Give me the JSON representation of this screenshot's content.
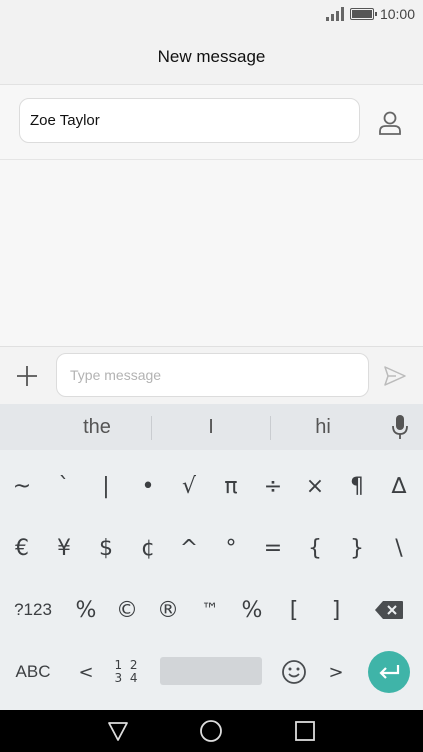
{
  "status_bar": {
    "time": "10:00",
    "signal_icon": "signal-icon",
    "battery_icon": "battery-icon",
    "battery_level": 1.0
  },
  "header": {
    "title": "New message"
  },
  "recipient": {
    "value": "Zoe Taylor",
    "contact_icon": "contact-icon"
  },
  "composer": {
    "placeholder": "Type message",
    "value": "",
    "add_icon": "plus-icon",
    "send_icon": "send-icon"
  },
  "keyboard": {
    "suggestions": [
      "the",
      "I",
      "hi"
    ],
    "mic_icon": "microphone-icon",
    "row1": [
      "~",
      "`",
      "|",
      "•",
      "√",
      "π",
      "÷",
      "×",
      "¶",
      "∆"
    ],
    "row2": [
      "€",
      "¥",
      "$",
      "¢",
      "^",
      "°",
      "=",
      "{",
      "}",
      "\\"
    ],
    "row3": {
      "mode": "?123",
      "keys": [
        "%",
        "©",
        "®",
        "™",
        "%",
        "[",
        "]"
      ],
      "backspace_icon": "backspace-icon"
    },
    "row4": {
      "abc": "ABC",
      "lt": "<",
      "num_line1": "1 2",
      "num_line2": "3 4",
      "emoji_icon": "emoji-icon",
      "gt": ">",
      "enter_icon": "enter-icon"
    }
  },
  "nav_bar": {
    "back_icon": "back-icon",
    "home_icon": "home-icon",
    "recents_icon": "recents-icon"
  },
  "colors": {
    "accent": "#3fb4a8",
    "keyboard_bg": "#eceff1"
  }
}
